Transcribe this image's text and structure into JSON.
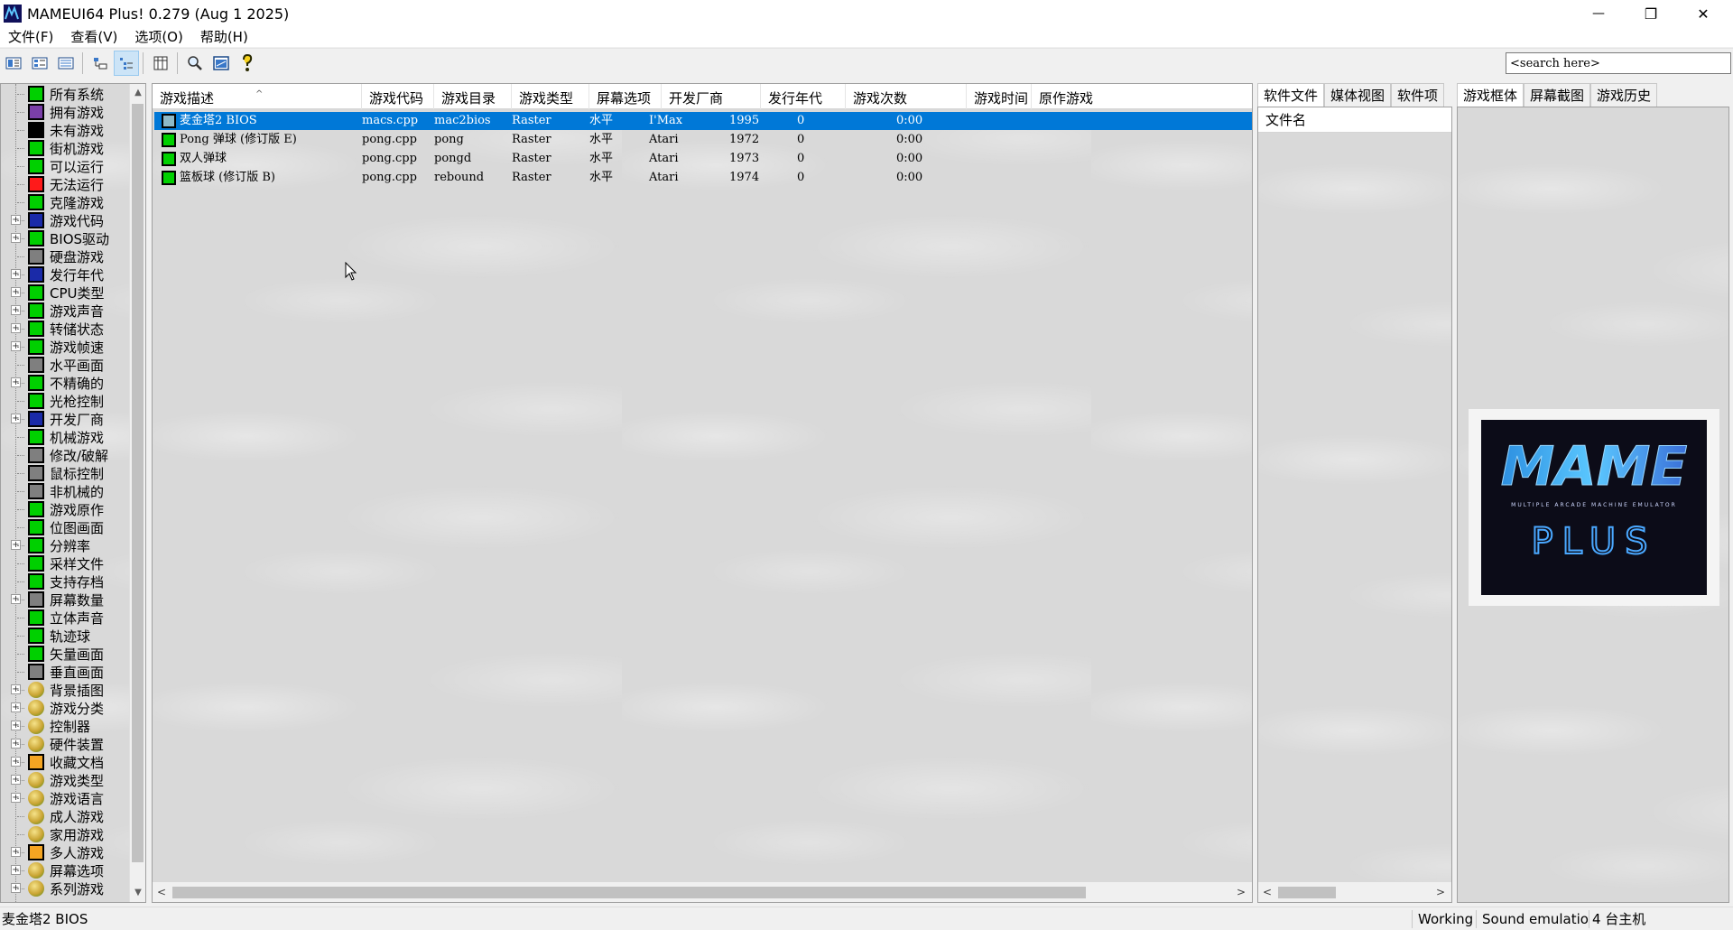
{
  "window": {
    "title": "MAMEUI64 Plus! 0.279 (Aug  1 2025)",
    "minimize_glyph": "—",
    "maximize_glyph": "❐",
    "close_glyph": "✕"
  },
  "menu": [
    "文件(F)",
    "查看(V)",
    "选项(O)",
    "帮助(H)"
  ],
  "toolbar": {
    "icons": [
      "view-large-icons-icon",
      "view-small-icons-icon",
      "view-list-icon",
      "view-grouped-icon",
      "view-details-icon",
      "columns-icon",
      "search-icon",
      "screenshot-icon",
      "help-icon"
    ]
  },
  "search": {
    "placeholder": "<search here>"
  },
  "tree": {
    "items": [
      {
        "label": "所有系统",
        "icon": "green",
        "expander": false
      },
      {
        "label": "拥有游戏",
        "icon": "purple",
        "expander": false
      },
      {
        "label": "未有游戏",
        "icon": "black",
        "expander": false
      },
      {
        "label": "街机游戏",
        "icon": "green",
        "expander": false
      },
      {
        "label": "可以运行",
        "icon": "green",
        "expander": false
      },
      {
        "label": "无法运行",
        "icon": "red",
        "expander": false
      },
      {
        "label": "克隆游戏",
        "icon": "green",
        "expander": false
      },
      {
        "label": "游戏代码",
        "icon": "blue",
        "expander": true
      },
      {
        "label": "BIOS驱动",
        "icon": "green",
        "expander": true
      },
      {
        "label": "硬盘游戏",
        "icon": "gray",
        "expander": false
      },
      {
        "label": "发行年代",
        "icon": "blue",
        "expander": true
      },
      {
        "label": "CPU类型",
        "icon": "green",
        "expander": true
      },
      {
        "label": "游戏声音",
        "icon": "green",
        "expander": true
      },
      {
        "label": "转储状态",
        "icon": "green",
        "expander": true
      },
      {
        "label": "游戏帧速",
        "icon": "green",
        "expander": true
      },
      {
        "label": "水平画面",
        "icon": "gray",
        "expander": false
      },
      {
        "label": "不精确的",
        "icon": "green",
        "expander": true
      },
      {
        "label": "光枪控制",
        "icon": "green",
        "expander": false
      },
      {
        "label": "开发厂商",
        "icon": "blue",
        "expander": true
      },
      {
        "label": "机械游戏",
        "icon": "green",
        "expander": false
      },
      {
        "label": "修改/破解",
        "icon": "gray",
        "expander": false
      },
      {
        "label": "鼠标控制",
        "icon": "gray",
        "expander": false
      },
      {
        "label": "非机械的",
        "icon": "gray",
        "expander": false
      },
      {
        "label": "游戏原作",
        "icon": "green",
        "expander": false
      },
      {
        "label": "位图画面",
        "icon": "green",
        "expander": false
      },
      {
        "label": "分辨率",
        "icon": "green",
        "expander": true
      },
      {
        "label": "采样文件",
        "icon": "green",
        "expander": false
      },
      {
        "label": "支持存档",
        "icon": "green",
        "expander": false
      },
      {
        "label": "屏幕数量",
        "icon": "gray",
        "expander": true
      },
      {
        "label": "立体声音",
        "icon": "green",
        "expander": false
      },
      {
        "label": "轨迹球",
        "icon": "green",
        "expander": false
      },
      {
        "label": "矢量画面",
        "icon": "green",
        "expander": false
      },
      {
        "label": "垂直画面",
        "icon": "gray",
        "expander": false
      },
      {
        "label": "背景插图",
        "icon": "ball",
        "expander": true
      },
      {
        "label": "游戏分类",
        "icon": "ball",
        "expander": true
      },
      {
        "label": "控制器",
        "icon": "ball",
        "expander": true
      },
      {
        "label": "硬件装置",
        "icon": "ball",
        "expander": true
      },
      {
        "label": "收藏文档",
        "icon": "orange",
        "expander": true
      },
      {
        "label": "游戏类型",
        "icon": "ball",
        "expander": true
      },
      {
        "label": "游戏语言",
        "icon": "ball",
        "expander": true
      },
      {
        "label": "成人游戏",
        "icon": "ball",
        "expander": false
      },
      {
        "label": "家用游戏",
        "icon": "ball",
        "expander": false
      },
      {
        "label": "多人游戏",
        "icon": "orange",
        "expander": true
      },
      {
        "label": "屏幕选项",
        "icon": "ball",
        "expander": true
      },
      {
        "label": "系列游戏",
        "icon": "ball",
        "expander": true
      }
    ]
  },
  "list": {
    "columns": [
      "游戏描述",
      "游戏代码",
      "游戏目录",
      "游戏类型",
      "屏幕选项",
      "开发厂商",
      "发行年代",
      "游戏次数",
      "游戏时间",
      "原作游戏"
    ],
    "sort_caret": "^",
    "rows": [
      {
        "desc": "麦金塔2 BIOS",
        "source": "macs.cpp",
        "dir": "mac2bios",
        "type": "Raster",
        "screen": "水平",
        "maker": "I'Max",
        "year": "1995",
        "plays": "0",
        "time": "0:00",
        "parent": "",
        "selected": true
      },
      {
        "desc": "Pong 弹球 (修订版 E)",
        "source": "pong.cpp",
        "dir": "pong",
        "type": "Raster",
        "screen": "水平",
        "maker": "Atari",
        "year": "1972",
        "plays": "0",
        "time": "0:00",
        "parent": "",
        "selected": false
      },
      {
        "desc": "双人弹球",
        "source": "pong.cpp",
        "dir": "pongd",
        "type": "Raster",
        "screen": "水平",
        "maker": "Atari",
        "year": "1973",
        "plays": "0",
        "time": "0:00",
        "parent": "",
        "selected": false
      },
      {
        "desc": "篮板球 (修订版 B)",
        "source": "pong.cpp",
        "dir": "rebound",
        "type": "Raster",
        "screen": "水平",
        "maker": "Atari",
        "year": "1974",
        "plays": "0",
        "time": "0:00",
        "parent": "",
        "selected": false
      }
    ]
  },
  "software_panel": {
    "tabs": [
      "软件文件",
      "媒体视图",
      "软件项"
    ],
    "header": "文件名"
  },
  "right_panel": {
    "tabs": [
      "游戏框体",
      "屏幕截图",
      "游戏历史"
    ],
    "logo_title": "MAME",
    "logo_subtitle": "MULTIPLE ARCADE MACHINE EMULATOR",
    "logo_plus": "PLUS"
  },
  "status": {
    "left": "麦金塔2 BIOS",
    "working": "Working",
    "sound": "Sound emulatio",
    "count": "4 台主机"
  },
  "colors": {
    "selection": "#0078d7",
    "green": "#00d000",
    "red": "#ff1a1a",
    "blue": "#1a2aa8",
    "purple": "#7a3fa8",
    "gray": "#7f7f7f",
    "orange": "#f4a522",
    "black": "#000000"
  }
}
